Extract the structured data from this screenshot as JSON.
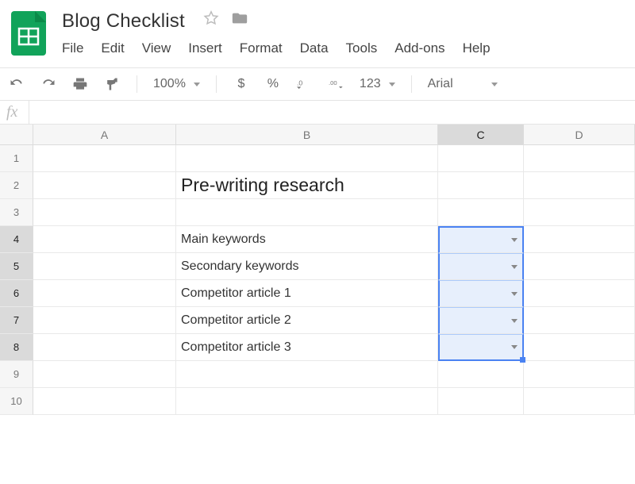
{
  "doc": {
    "title": "Blog Checklist"
  },
  "menu": {
    "file": "File",
    "edit": "Edit",
    "view": "View",
    "insert": "Insert",
    "format": "Format",
    "data": "Data",
    "tools": "Tools",
    "addons": "Add-ons",
    "help": "Help"
  },
  "toolbar": {
    "zoom": "100%",
    "currency": "$",
    "percent": "%",
    "dec_less": ".0",
    "dec_more": ".00",
    "numfmt": "123",
    "font": "Arial"
  },
  "fx": {
    "label": "fx",
    "value": ""
  },
  "columns": [
    "A",
    "B",
    "C",
    "D"
  ],
  "rows": [
    "1",
    "2",
    "3",
    "4",
    "5",
    "6",
    "7",
    "8",
    "9",
    "10"
  ],
  "cells": {
    "B2": "Pre-writing research",
    "B4": "Main keywords",
    "B5": "Secondary keywords",
    "B6": "Competitor article 1",
    "B7": "Competitor article 2",
    "B8": "Competitor article 3"
  },
  "selected_col": "C",
  "selected_rows": [
    "4",
    "5",
    "6",
    "7",
    "8"
  ]
}
